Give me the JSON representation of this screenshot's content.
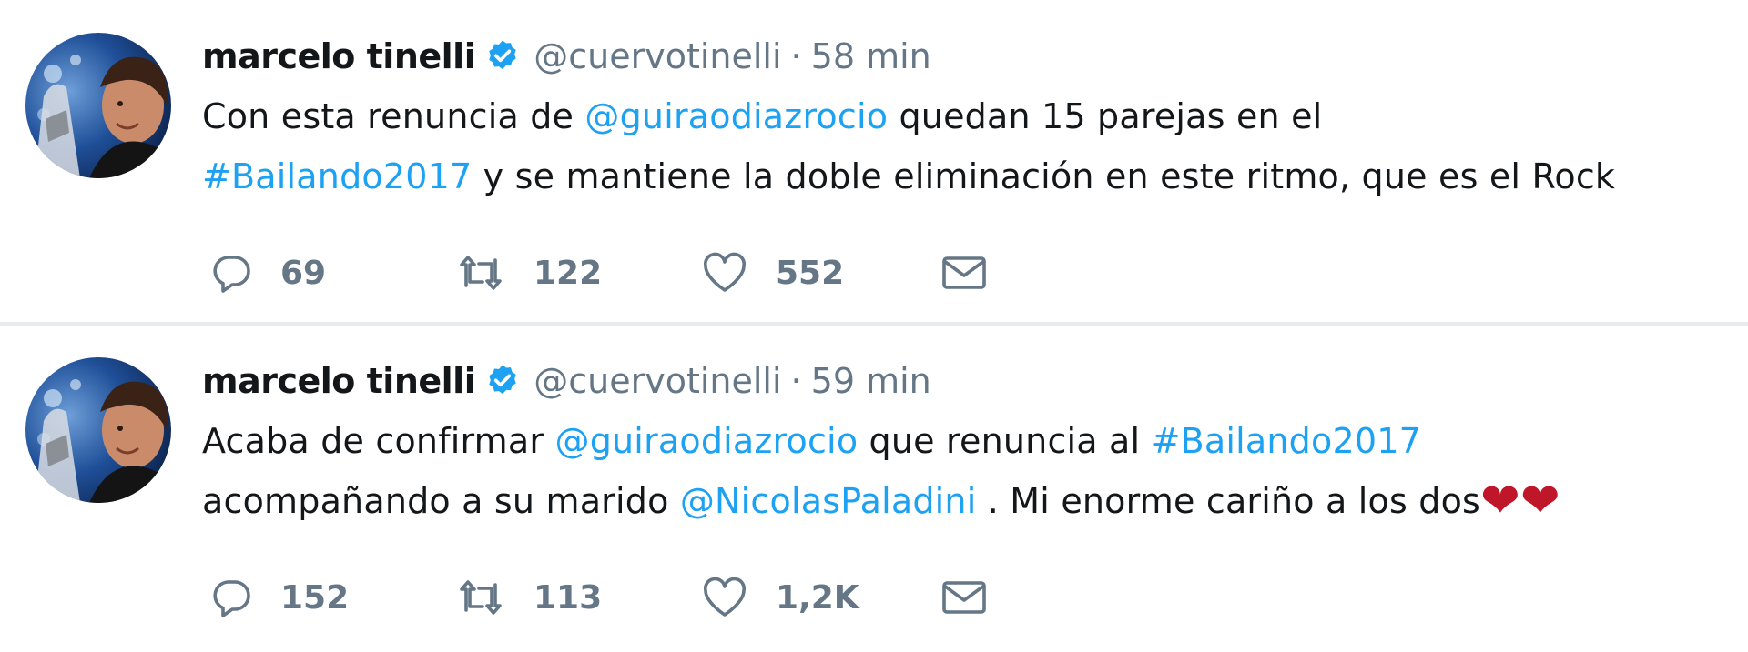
{
  "tweets": [
    {
      "author_name": "marcelo tinelli",
      "handle": "@cuervotinelli",
      "separator": "·",
      "time": "58 min",
      "text_lines": [
        [
          {
            "t": "Con esta renuncia de ",
            "link": false
          },
          {
            "t": "@guiraodiazrocio",
            "link": true
          },
          {
            "t": " quedan 15 parejas en el",
            "link": false
          }
        ],
        [
          {
            "t": "#Bailando2017",
            "link": true
          },
          {
            "t": " y se mantiene la doble eliminación en este ritmo, que es el Rock",
            "link": false
          }
        ]
      ],
      "replies": "69",
      "retweets": "122",
      "likes": "552"
    },
    {
      "author_name": "marcelo tinelli",
      "handle": "@cuervotinelli",
      "separator": "·",
      "time": "59 min",
      "text_lines": [
        [
          {
            "t": "Acaba de confirmar ",
            "link": false
          },
          {
            "t": "@guiraodiazrocio",
            "link": true
          },
          {
            "t": " que renuncia al ",
            "link": false
          },
          {
            "t": "#Bailando2017",
            "link": true
          }
        ],
        [
          {
            "t": "acompañando a su marido ",
            "link": false
          },
          {
            "t": "@NicolasPaladini",
            "link": true
          },
          {
            "t": " . Mi enorme cariño a los dos",
            "link": false
          },
          {
            "t": "❤❤",
            "link": false,
            "emoji": true
          }
        ]
      ],
      "replies": "152",
      "retweets": "113",
      "likes": "1,2K"
    }
  ],
  "icons": {
    "reply": "reply-icon",
    "retweet": "retweet-icon",
    "like": "like-icon",
    "dm": "direct-message-icon",
    "verified": "verified-badge-icon"
  },
  "colors": {
    "link": "#1da1f2",
    "text": "#14171a",
    "muted": "#657786",
    "verified": "#1da1f2",
    "heart": "#c0162a",
    "divider": "#e6ecf0"
  }
}
